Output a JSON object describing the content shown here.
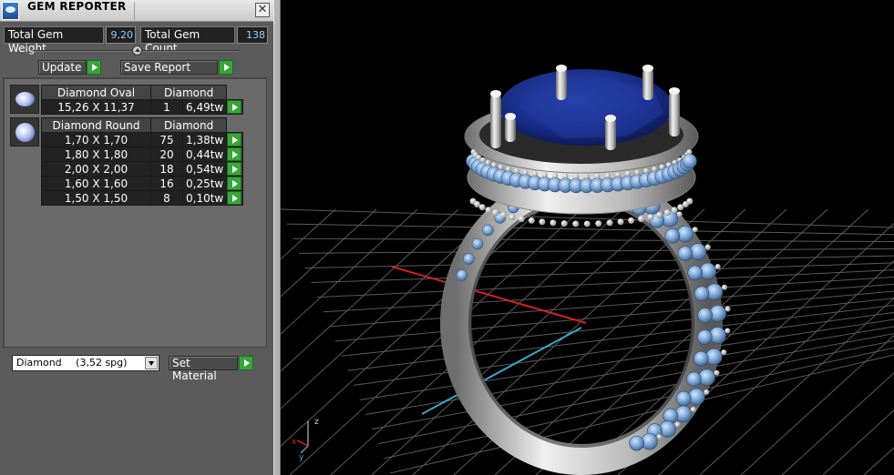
{
  "window": {
    "title": "GEM REPORTER",
    "close_glyph": "✕",
    "icon": "gem-reporter-icon"
  },
  "stats": {
    "weight_label": "Total Gem Weight",
    "weight_value": "9,20",
    "count_label": "Total Gem Count",
    "count_value": "138"
  },
  "actions": {
    "update_label": "Update",
    "save_report_label": "Save Report"
  },
  "gems": [
    {
      "name": "Diamond Oval",
      "material": "Diamond",
      "shape_icon": "oval-gem-icon",
      "rows": [
        {
          "size": "15,26 X 11,37",
          "count": "1",
          "weight": "6,49tw"
        }
      ]
    },
    {
      "name": "Diamond Round",
      "material": "Diamond",
      "shape_icon": "round-gem-icon",
      "rows": [
        {
          "size": "1,70 X 1,70",
          "count": "75",
          "weight": "1,38tw"
        },
        {
          "size": "1,80 X 1,80",
          "count": "20",
          "weight": "0,44tw"
        },
        {
          "size": "2,00 X 2,00",
          "count": "18",
          "weight": "0,54tw"
        },
        {
          "size": "1,60 X 1,60",
          "count": "16",
          "weight": "0,25tw"
        },
        {
          "size": "1,50 X 1,50",
          "count": "8",
          "weight": "0,10tw"
        }
      ]
    }
  ],
  "material": {
    "selected_name": "Diamond",
    "selected_density": "(3,52 spg)",
    "set_label": "Set Material"
  },
  "viewport": {
    "axis_z": "z",
    "axis_x": "x",
    "axis_y": "y",
    "colors": {
      "background": "#000000",
      "grid": "#5a5a5a",
      "x_axis": "#d42020",
      "y_axis": "#3aa6c8",
      "metal": "#c8c8c8",
      "center_stone": "#1a2f8a",
      "side_stones": "#7fa9d6"
    }
  }
}
